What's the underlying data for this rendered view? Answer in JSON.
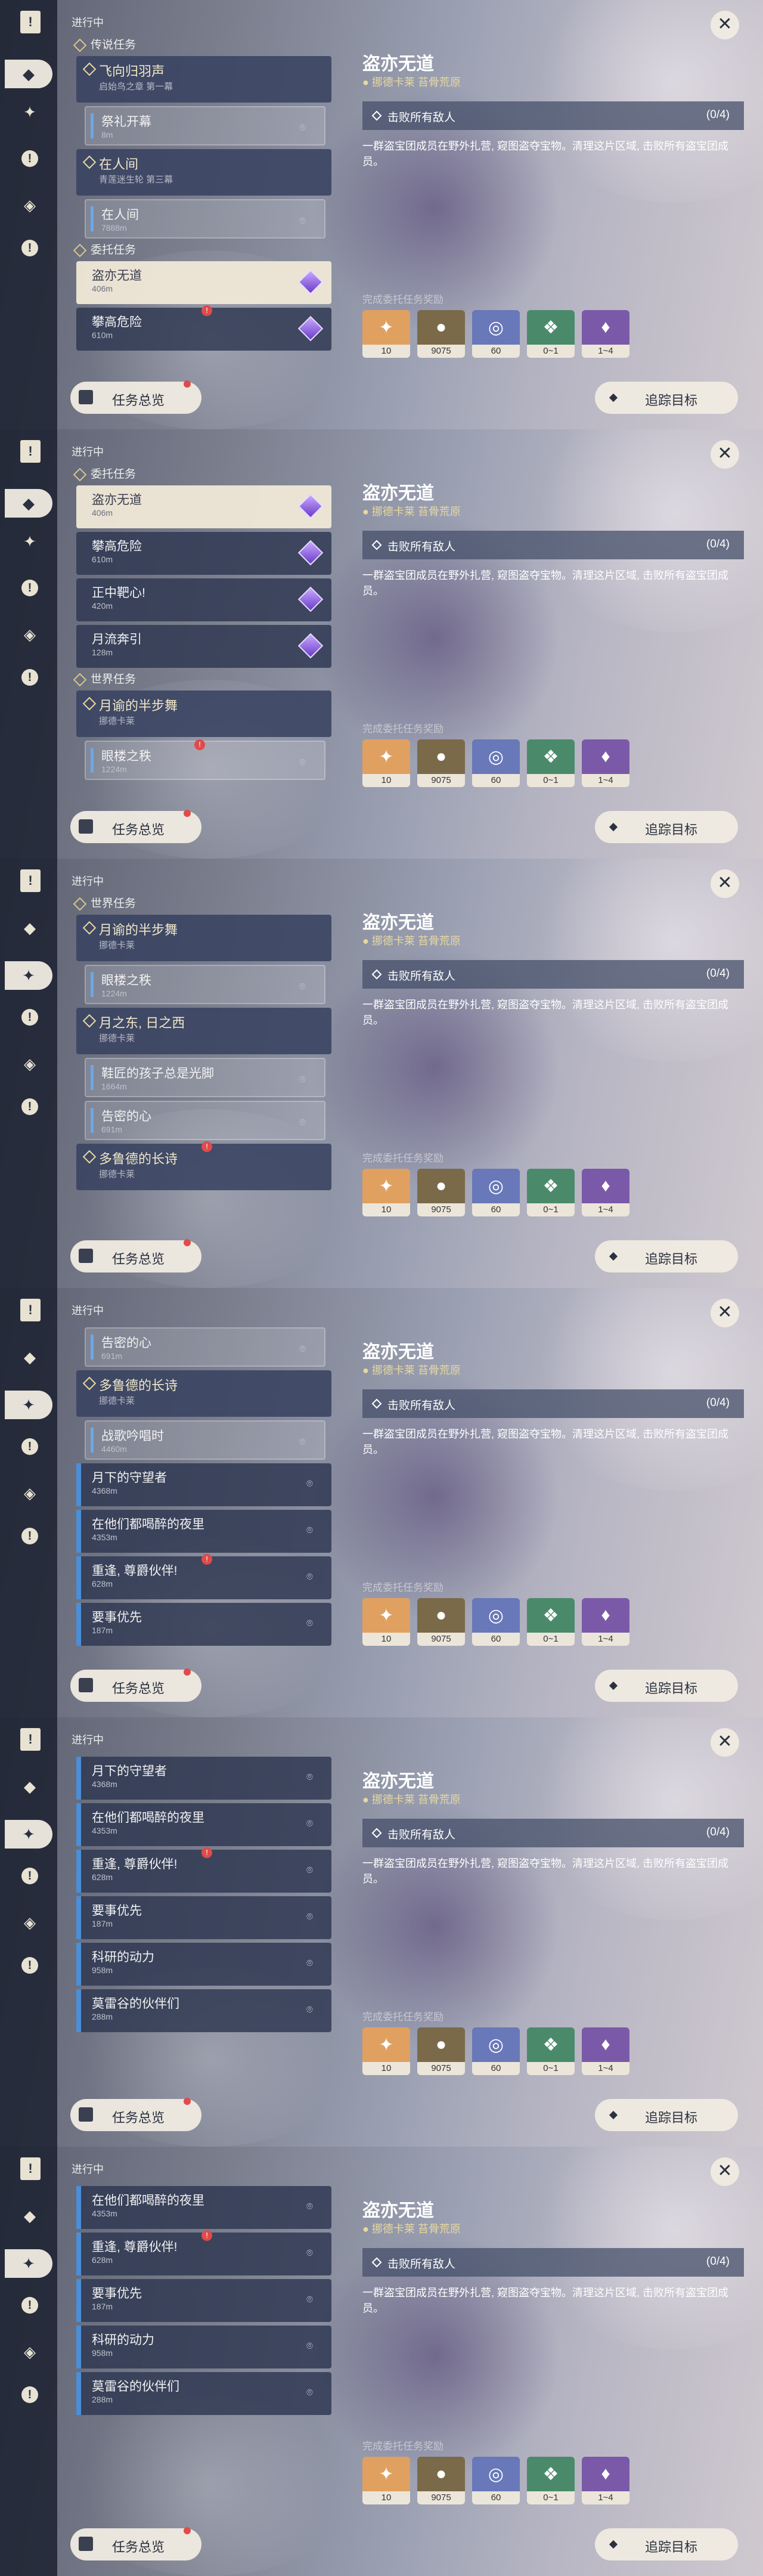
{
  "header": {
    "in_progress": "进行中"
  },
  "sections": {
    "legend": "传说任务",
    "commission": "委托任务",
    "world": "世界任务"
  },
  "quests": {
    "q1": {
      "title": "飞向归羽声",
      "sub": "启始鸟之章 第一幕"
    },
    "q1a": {
      "title": "祭礼开幕",
      "dist": "8m"
    },
    "q2": {
      "title": "在人间",
      "sub": "青莲迷生轮 第三幕"
    },
    "q2a": {
      "title": "在人间",
      "dist": "7888m"
    },
    "c1": {
      "title": "盗亦无道",
      "dist": "406m"
    },
    "c2": {
      "title": "攀高危险",
      "dist": "610m"
    },
    "c3": {
      "title": "正中靶心!",
      "dist": "420m"
    },
    "c4": {
      "title": "月流奔引",
      "dist": "128m"
    },
    "w1": {
      "title": "月谕的半步舞",
      "sub": "挪德卡莱"
    },
    "w1a": {
      "title": "眼楼之秩",
      "dist": "1224m"
    },
    "w2": {
      "title": "月之东, 日之西",
      "sub": "挪德卡莱"
    },
    "w2a": {
      "title": "鞋匠的孩子总是光脚",
      "dist": "1664m"
    },
    "w2b": {
      "title": "告密的心",
      "dist": "691m"
    },
    "w3": {
      "title": "多鲁德的长诗",
      "sub": "挪德卡莱"
    },
    "w3a": {
      "title": "战歌吟唱时",
      "dist": "4460m"
    },
    "e1": {
      "title": "月下的守望者",
      "dist": "4368m"
    },
    "e2": {
      "title": "在他们都喝醉的夜里",
      "dist": "4353m"
    },
    "e3": {
      "title": "重逢, 尊爵伙伴!",
      "dist": "628m"
    },
    "e4": {
      "title": "要事优先",
      "dist": "187m"
    },
    "e5": {
      "title": "科研的动力",
      "dist": "958m"
    },
    "e6": {
      "title": "莫雷谷的伙伴们",
      "dist": "288m"
    }
  },
  "detail": {
    "title": "盗亦无道",
    "location": "挪德卡莱 苔骨荒原",
    "objective": "击败所有敌人",
    "progress": "(0/4)",
    "description": "一群盗宝团成员在野外扎营, 窥图盗夺宝物。清理这片区域, 击败所有盗宝团成员。",
    "rewards_label": "完成委托任务奖励",
    "rewards": [
      {
        "icon": "star-icon",
        "count": "10",
        "color": "#e0a060"
      },
      {
        "icon": "mora-icon",
        "count": "9075",
        "color": "#7a6a4a"
      },
      {
        "icon": "exp-icon",
        "count": "60",
        "color": "#6878b8"
      },
      {
        "icon": "crystal-icon",
        "count": "0~1",
        "color": "#4a8a6a"
      },
      {
        "icon": "crystal-purple-icon",
        "count": "1~4",
        "color": "#7a5aa8"
      }
    ]
  },
  "buttons": {
    "overview": "任务总览",
    "track": "追踪目标",
    "close": "✕"
  }
}
